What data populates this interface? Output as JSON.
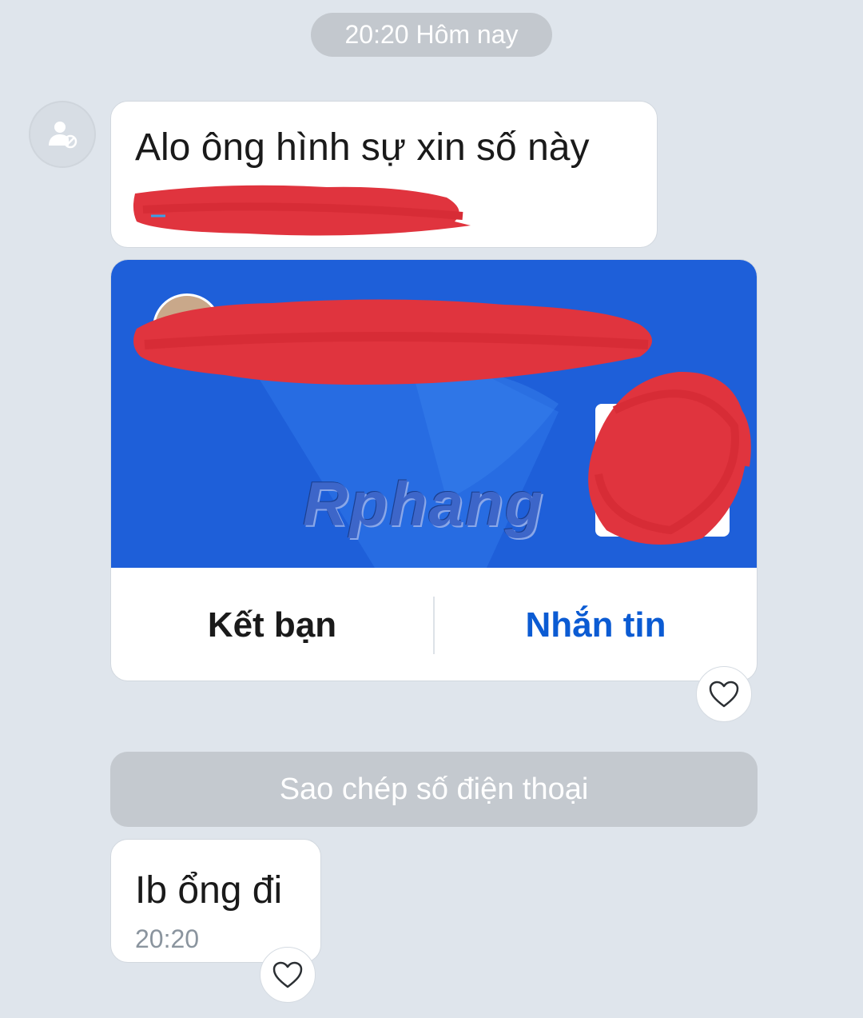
{
  "header": {
    "timestamp_label": "20:20 Hôm nay"
  },
  "messages": {
    "first": {
      "text": "Alo ông hình sự xin số này"
    },
    "second": {
      "text": "Ib ổng đi",
      "time": "20:20"
    }
  },
  "contact_card": {
    "add_friend_label": "Kết bạn",
    "message_label": "Nhắn tin",
    "watermark": "Rphang"
  },
  "actions": {
    "copy_phone_label": "Sao chép số điện thoại"
  },
  "icons": {
    "avatar": "user-blocked-icon",
    "reaction": "heart-icon"
  },
  "colors": {
    "background": "#dfe5ec",
    "card_blue": "#1e5fd9",
    "accent_blue": "#0b5bd3",
    "redaction_red": "#e0343e"
  }
}
